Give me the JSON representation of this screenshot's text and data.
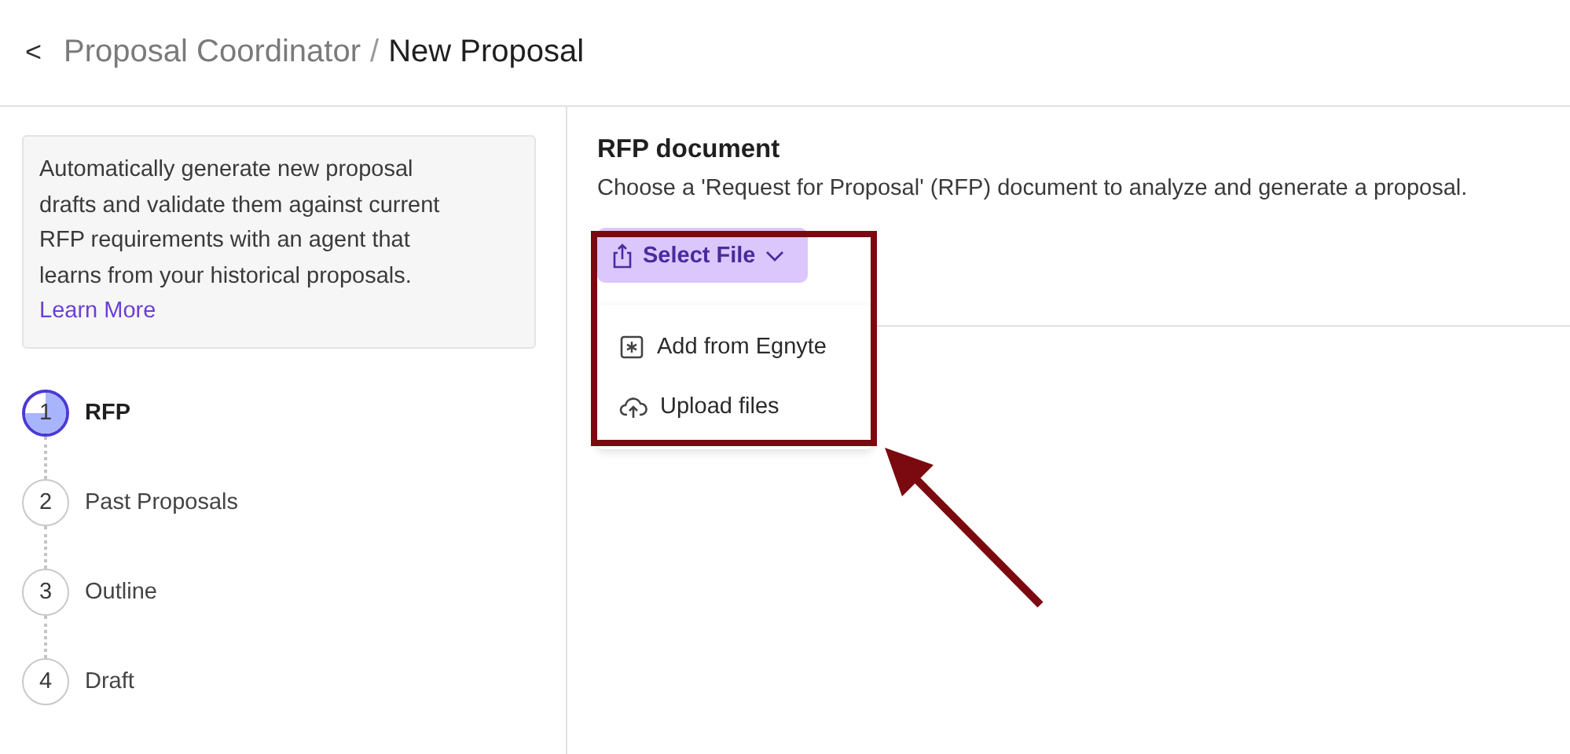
{
  "header": {
    "back_icon": "<",
    "breadcrumb": [
      {
        "label": "Proposal Coordinator",
        "selected": false
      },
      {
        "label": "New Proposal",
        "selected": true
      }
    ],
    "separator": "/"
  },
  "sidebar": {
    "info": "Automatically generate new proposal drafts and validate them against current RFP requirements with an agent that learns from your historical proposals.",
    "link": "Learn More",
    "steps": [
      {
        "number": "1",
        "label": "RFP",
        "selected": true
      },
      {
        "number": "2",
        "label": "Past Proposals",
        "selected": false
      },
      {
        "number": "3",
        "label": "Outline",
        "selected": false
      },
      {
        "number": "4",
        "label": "Draft",
        "selected": false
      }
    ]
  },
  "main": {
    "title": "RFP document",
    "description": "Choose a 'Request for Proposal' (RFP) document to analyze and generate a proposal.",
    "select_button": "Select File",
    "menu": {
      "expanded": true,
      "items": [
        {
          "kind": "egnyte",
          "label": "Add from Egnyte"
        },
        {
          "kind": "upload",
          "label": "Upload files"
        }
      ]
    }
  },
  "annotation": {
    "highlight": true
  }
}
